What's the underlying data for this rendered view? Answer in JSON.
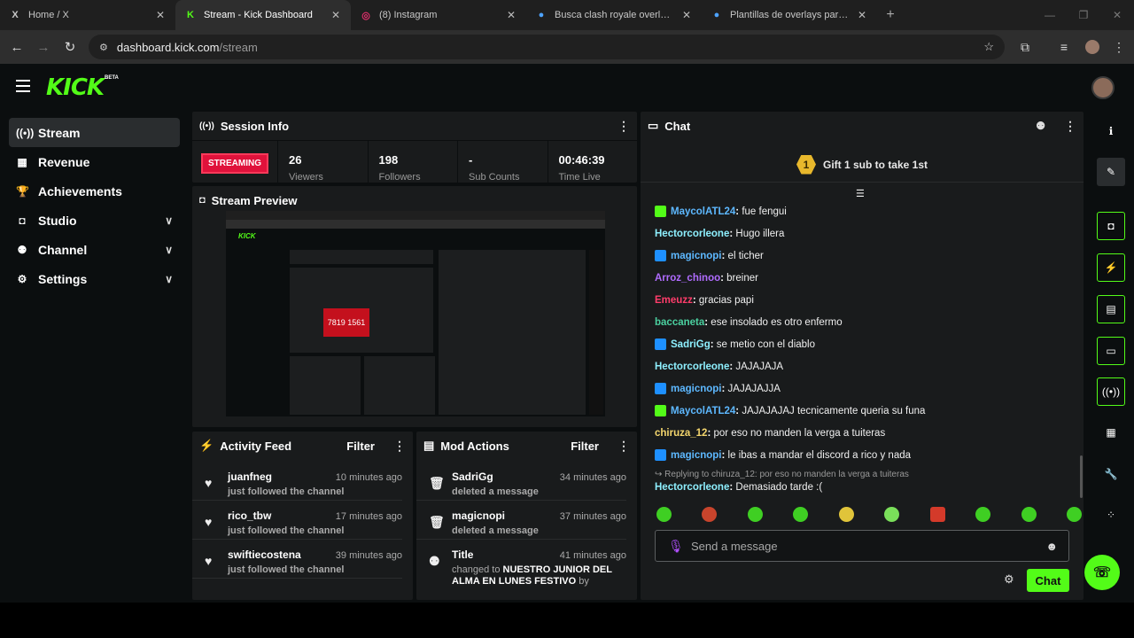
{
  "browser": {
    "tabs": [
      {
        "icon": "X",
        "title": "Home / X"
      },
      {
        "icon": "K",
        "title": "Stream - Kick Dashboard"
      },
      {
        "icon": "◎",
        "title": "(8) Instagram"
      },
      {
        "icon": "●",
        "title": "Busca clash royale overlay - Ca"
      },
      {
        "icon": "●",
        "title": "Plantillas de overlays para Twit"
      }
    ],
    "url_host": "dashboard.kick.com",
    "url_path": "/stream"
  },
  "app": {
    "logo": "KICK",
    "beta": "BETA"
  },
  "sidebar": {
    "items": [
      {
        "label": "Stream",
        "icon": "((•))"
      },
      {
        "label": "Revenue",
        "icon": "▦"
      },
      {
        "label": "Achievements",
        "icon": "🏆"
      },
      {
        "label": "Studio",
        "icon": "◘"
      },
      {
        "label": "Channel",
        "icon": "⚉"
      },
      {
        "label": "Settings",
        "icon": "⚙"
      }
    ]
  },
  "session": {
    "title": "Session Info",
    "status": "STREAMING",
    "stats": [
      {
        "value": "26",
        "label": "Viewers"
      },
      {
        "value": "198",
        "label": "Followers"
      },
      {
        "value": "-",
        "label": "Sub Counts"
      },
      {
        "value": "00:46:39",
        "label": "Time Live"
      }
    ]
  },
  "preview": {
    "title": "Stream Preview",
    "overlay_text": "7819 1561"
  },
  "activity": {
    "title": "Activity Feed",
    "filter": "Filter",
    "items": [
      {
        "user": "juanfneg",
        "action": "just followed the channel",
        "time": "10 minutes ago"
      },
      {
        "user": "rico_tbw",
        "action": "just followed the channel",
        "time": "17 minutes ago"
      },
      {
        "user": "swiftiecostena",
        "action": "just followed the channel",
        "time": "39 minutes ago"
      }
    ]
  },
  "mod": {
    "title": "Mod Actions",
    "filter": "Filter",
    "items": [
      {
        "user": "SadriGg",
        "action": "deleted a message",
        "time": "34 minutes ago"
      },
      {
        "user": "magicnopi",
        "action": "deleted a message",
        "time": "37 minutes ago"
      },
      {
        "user": "Title",
        "action": "changed to",
        "bold": "NUESTRO JUNIOR DEL ALMA EN LUNES FESTIVO",
        "by": "by",
        "time": "41 minutes ago"
      }
    ]
  },
  "chat": {
    "title": "Chat",
    "gift_rank": "1",
    "gift": "Gift 1 sub to take 1st",
    "messages": [
      {
        "badge": "g",
        "user": "MaycolATL24",
        "color": "#5db8ff",
        "text": "fue fengui"
      },
      {
        "badge": "",
        "user": "Hectorcorleone",
        "color": "#8ef0ff",
        "text": "Hugo illera"
      },
      {
        "badge": "b",
        "user": "magicnopi",
        "color": "#5db8ff",
        "text": "el ticher"
      },
      {
        "badge": "",
        "user": "Arroz_chinoo",
        "color": "#b06cff",
        "text": "breiner"
      },
      {
        "badge": "",
        "user": "Emeuzz",
        "color": "#ff3d6b",
        "text": "gracias papi"
      },
      {
        "badge": "",
        "user": "baccaneta",
        "color": "#4bd1a0",
        "text": "ese insolado es otro enfermo"
      },
      {
        "badge": "b",
        "user": "SadriGg",
        "color": "#8ef0ff",
        "text": "se metio con el diablo"
      },
      {
        "badge": "",
        "user": "Hectorcorleone",
        "color": "#8ef0ff",
        "text": "JAJAJAJA"
      },
      {
        "badge": "b",
        "user": "magicnopi",
        "color": "#5db8ff",
        "text": "JAJAJAJJA"
      },
      {
        "badge": "g",
        "user": "MaycolATL24",
        "color": "#5db8ff",
        "text": "JAJAJAJAJ tecnicamente queria su funa"
      },
      {
        "badge": "",
        "user": "chiruza_12",
        "color": "#f5d76e",
        "text": "por eso no manden la verga a tuiteras"
      },
      {
        "badge": "b",
        "user": "magicnopi",
        "color": "#5db8ff",
        "text": "le ibas a mandar el discord a rico y nada"
      }
    ],
    "reply_to": "↪ Replying to chiruza_12: por eso no manden la verga a tuiteras",
    "last_user": "Hectorcorleone",
    "last_text": "Demasiado tarde :(",
    "placeholder": "Send a message",
    "send_label": "Chat"
  }
}
